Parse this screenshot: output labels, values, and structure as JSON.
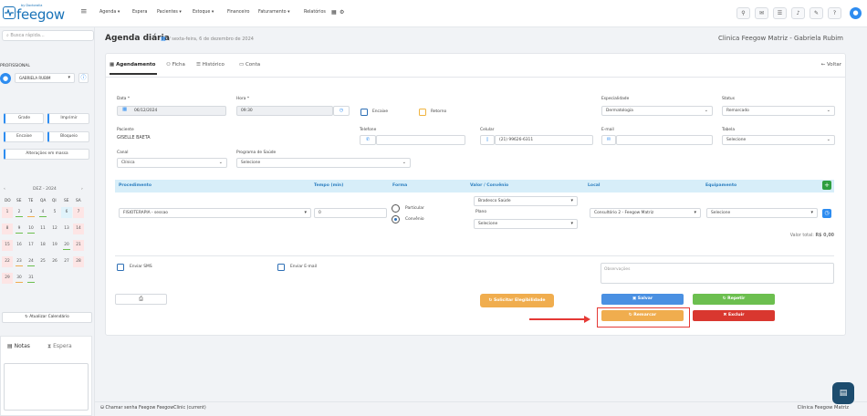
{
  "brand": {
    "logo_sub": "by Doctoralia",
    "logo_text": "feegow"
  },
  "nav": {
    "items": [
      "Agenda ▾",
      "Espera",
      "Pacientes ▾",
      "Estoque ▾",
      "Financeiro",
      "Faturamento ▾",
      "Relatórios"
    ]
  },
  "sidebar": {
    "search_placeholder": "Busca rápida...",
    "profissional_label": "PROFISSIONAL",
    "profissional_value": "GABRIELA RUBIM",
    "buttons": {
      "grade": "Grade",
      "imprimir": "Imprimir",
      "encaixe": "Encaixe",
      "bloqueio": "Bloqueio",
      "alteracoes": "Alterações em massa"
    },
    "calendar": {
      "month": "DEZ - 2024",
      "dow": [
        "DO",
        "SE",
        "TE",
        "QA",
        "QI",
        "SE",
        "SA"
      ],
      "update_label": "Atualizar Calendário"
    },
    "notes_tab": "Notas",
    "espera_tab": "Espera"
  },
  "header": {
    "title": "Agenda diária",
    "date_text": "/ sexta-feira, 6 de dezembro de 2024",
    "clinic": "Clinica Feegow Matriz - Gabriela Rubim"
  },
  "tabs": {
    "agendamento": "Agendamento",
    "ficha": "Ficha",
    "historico": "Histórico",
    "conta": "Conta",
    "voltar": "Voltar"
  },
  "form": {
    "data_label": "Data *",
    "data_value": "06/12/2024",
    "hora_label": "Hora *",
    "hora_value": "09:30",
    "encaixe_label": "Encaixe",
    "retorno_label": "Retorno",
    "especialidade_label": "Especialidade",
    "especialidade_value": "Dermatologia",
    "status_label": "Status",
    "status_value": "Remarcado",
    "paciente_label": "Paciente",
    "paciente_value": "GISELLE BAETA",
    "telefone_label": "Telefone",
    "celular_label": "Celular",
    "celular_value": "(21) 99626-6311",
    "email_label": "E-mail",
    "tabela_label": "Tabela",
    "tabela_value": "Selecione",
    "canal_label": "Canal",
    "canal_value": "Clínica",
    "programa_label": "Programa de Saúde",
    "programa_value": "Selecione"
  },
  "procedures": {
    "headers": {
      "procedimento": "Procedimento",
      "tempo": "Tempo (min)",
      "forma": "Forma",
      "valor": "Valor / Convênio",
      "local": "Local",
      "equipamento": "Equipamento"
    },
    "row": {
      "procedimento": "FISIOTERAPIA - sessao",
      "tempo": "0",
      "forma_particular": "Particular",
      "forma_convenio": "Convênio",
      "convenio": "Bradesco Saúde",
      "plano_label": "Plano",
      "plano": "Selecione",
      "local": "Consultório 2 - Feegow Matriz",
      "equipamento": "Selecione"
    },
    "total_label": "Valor total:",
    "total_value": "R$ 0,00"
  },
  "options": {
    "sms": "Enviar SMS",
    "email": "Enviar E-mail",
    "obs_placeholder": "Observações"
  },
  "actions": {
    "elegibilidade": "Solicitar Elegibilidade",
    "salvar": "Salvar",
    "repetir": "Repetir",
    "remarcar": "Remarcar",
    "excluir": "Excluir"
  },
  "footer": {
    "left": "Chamar senha",
    "left2": "Feegow FeegowClinic (current)",
    "right": "Clinica Feegow Matriz"
  },
  "colors": {
    "primary": "#2d8cf0",
    "orange": "#f0ad4e",
    "green": "#5cb85c",
    "red": "#d9372f",
    "highlight": "#e53935"
  }
}
